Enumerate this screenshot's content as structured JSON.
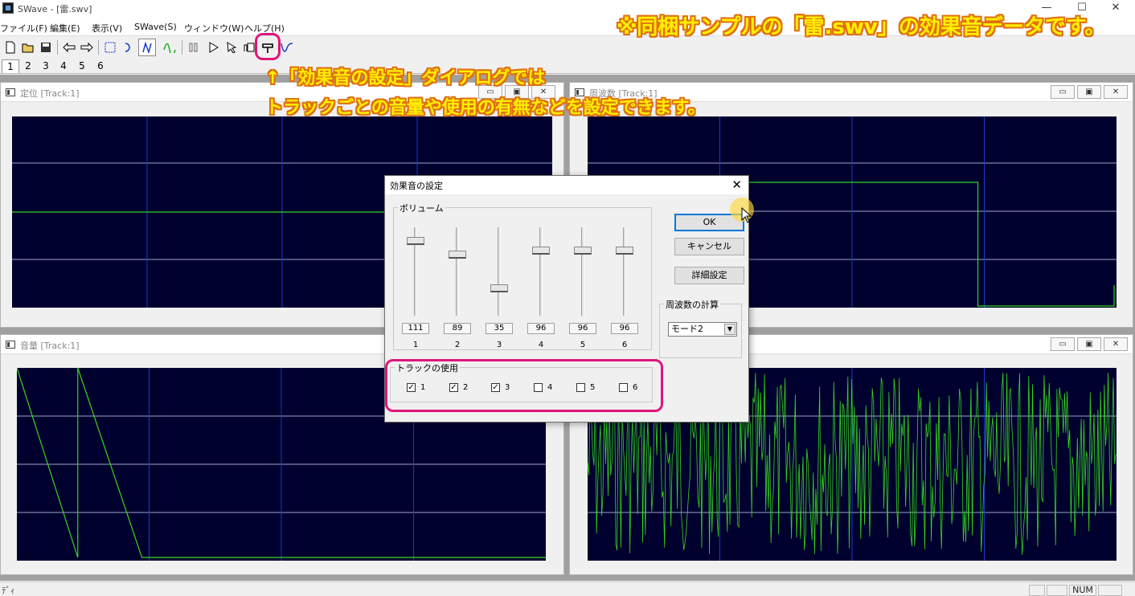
{
  "window": {
    "title": "SWave - [雷.swv]",
    "minimize": "—",
    "maximize": "☐",
    "close": "✕"
  },
  "menu": [
    "ファイル(F)",
    "編集(E)",
    "表示(V)",
    "SWave(S)",
    "ウィンドウ(W)",
    "ヘルプ(H)"
  ],
  "toolbar": {
    "icons": [
      "new-file-icon",
      "open-folder-icon",
      "save-icon",
      "undo-arrow-icon",
      "redo-arrow-icon",
      "select-rect-icon",
      "rotate-icon",
      "line-draw-icon",
      "wave-draw-icon",
      "pause-icon",
      "play-icon",
      "pointer-play-icon",
      "stop-icon",
      "effect-settings-icon",
      "curve-icon"
    ]
  },
  "track_tabs": [
    "1",
    "2",
    "3",
    "4",
    "5",
    "6"
  ],
  "panels": {
    "pan": {
      "title": "定位 [Track:1]"
    },
    "freq": {
      "title": "周波数 [Track:1]"
    },
    "volume": {
      "title": "音量 [Track:1]"
    }
  },
  "dialog": {
    "title": "効果音の設定",
    "volume_group": "ボリューム",
    "volumes": [
      111,
      89,
      35,
      96,
      96,
      96
    ],
    "volume_max": 127,
    "track_labels": [
      "1",
      "2",
      "3",
      "4",
      "5",
      "6"
    ],
    "track_use_group": "トラックの使用",
    "track_use": [
      true,
      true,
      true,
      false,
      false,
      false
    ],
    "ok": "OK",
    "cancel": "キャンセル",
    "details": "詳細設定",
    "freq_calc_group": "周波数の計算",
    "freq_mode": "モード2"
  },
  "status": {
    "text": "ﾃﾞｨ",
    "num": "NUM"
  },
  "annotations": {
    "top": "※同梱サンプルの「雷.swv」の効果音データです。",
    "line1": "↑「効果音の設定」ダイアログでは",
    "line2": "トラックごとの音量や使用の有無などを設定できます。"
  },
  "colors": {
    "plot_bg": "#00002f",
    "trace": "#39d61c",
    "grid_h": "#9aa6c8",
    "grid_v": "#1a3cc8",
    "highlight": "#e0157a",
    "annotation_text": "#ffee00",
    "annotation_outline": "#e07010"
  }
}
